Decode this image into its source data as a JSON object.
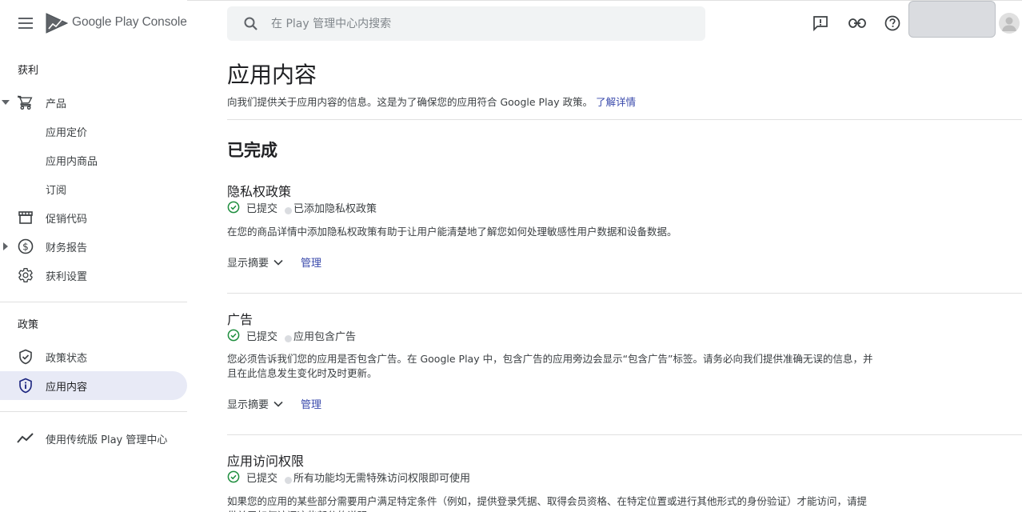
{
  "brand": {
    "google_play": "Google Play",
    "console": "Console"
  },
  "search": {
    "placeholder": "在 Play 管理中心内搜索"
  },
  "sidebar": {
    "monetize_label": "获利",
    "items_monetize": [
      {
        "label": "产品",
        "icon": "cart-icon",
        "expanded": true
      },
      {
        "label": "应用定价"
      },
      {
        "label": "应用内商品"
      },
      {
        "label": "订阅"
      },
      {
        "label": "促销代码",
        "icon": "store-icon"
      },
      {
        "label": "财务报告",
        "icon": "dollar-icon",
        "expanded": false
      },
      {
        "label": "获利设置",
        "icon": "gear-icon"
      }
    ],
    "policy_label": "政策",
    "items_policy": [
      {
        "label": "政策状态",
        "icon": "shield-check-icon"
      },
      {
        "label": "应用内容",
        "icon": "shield-info-icon",
        "active": true
      }
    ],
    "legacy": {
      "label": "使用传统版 Play 管理中心",
      "icon": "trending-icon"
    }
  },
  "page": {
    "title": "应用内容",
    "description": "向我们提供关于应用内容的信息。这是为了确保您的应用符合 Google Play 政策。",
    "learn_more": "了解详情",
    "completed_title": "已完成"
  },
  "cards": [
    {
      "title": "隐私权政策",
      "status": "已提交",
      "detail": "已添加隐私权政策",
      "description": "在您的商品详情中添加隐私权政策有助于让用户能清楚地了解您如何处理敏感性用户数据和设备数据。",
      "summary_label": "显示摘要",
      "manage_label": "管理"
    },
    {
      "title": "广告",
      "status": "已提交",
      "detail": "应用包含广告",
      "description": "您必须告诉我们您的应用是否包含广告。在 Google Play 中，包含广告的应用旁边会显示“包含广告”标签。请务必向我们提供准确无误的信息，并且在此信息发生变化时及时更新。",
      "summary_label": "显示摘要",
      "manage_label": "管理"
    },
    {
      "title": "应用访问权限",
      "status": "已提交",
      "detail": "所有功能均无需特殊访问权限即可使用",
      "description": "如果您的应用的某些部分需要用户满足特定条件（例如，提供登录凭据、取得会员资格、在特定位置或进行其他形式的身份验证）才能访问，请提供关于如何访问这些部分的说明。"
    }
  ],
  "colors": {
    "accent": "#3949ab",
    "success": "#1e8e3e",
    "active_bg": "#e8eaf6"
  }
}
